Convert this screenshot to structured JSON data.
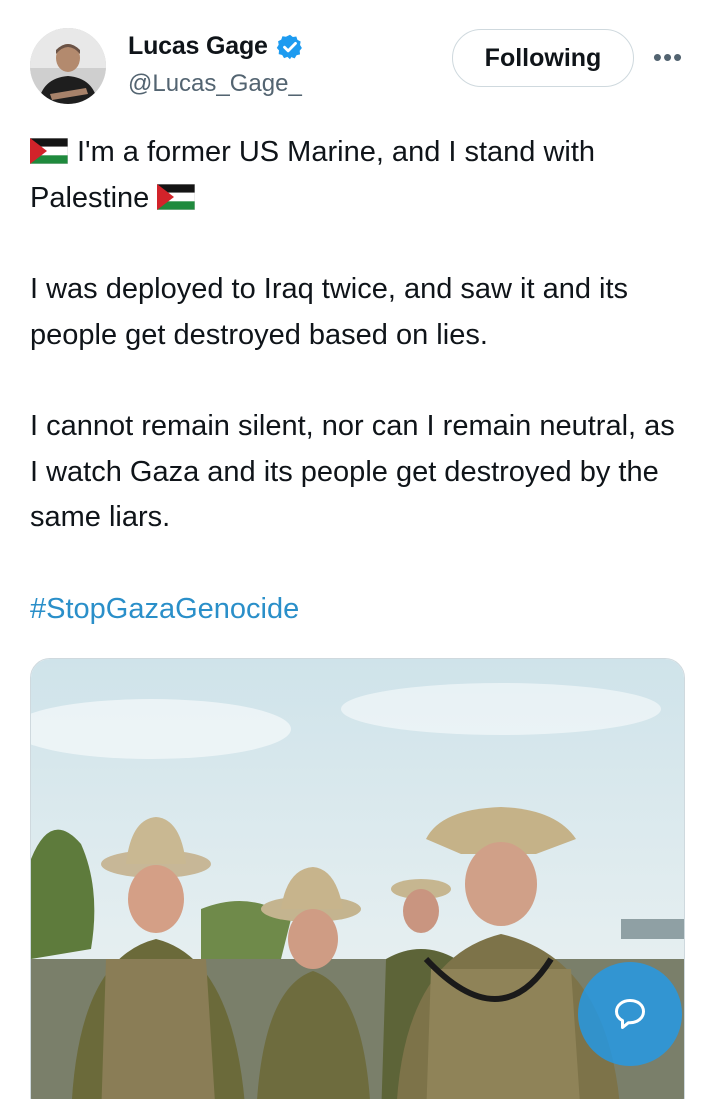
{
  "author": {
    "name": "Lucas Gage",
    "handle": "@Lucas_Gage_",
    "verified": true,
    "avatar_icon": "profile-photo"
  },
  "actions": {
    "follow_label": "Following",
    "more_label": "•••"
  },
  "tweet": {
    "line1": "I'm a former US Marine, and I stand with Palestine",
    "para2": "I was deployed to Iraq twice, and saw it and its people get destroyed based on lies.",
    "para3": "I cannot remain silent, nor can I remain neutral, as I watch Gaza and its people get destroyed by the same liars.",
    "hashtag": "#StopGazaGenocide",
    "flag_icon": "palestine-flag-icon"
  },
  "media": {
    "type": "photo",
    "icon": "photo-soldiers"
  },
  "colors": {
    "accent": "#1d9bf0",
    "hashtag": "#2a8fc9",
    "secondary_text": "#536471",
    "border": "#cfd9de",
    "flag_red": "#d2232a",
    "flag_green": "#1f8a3d"
  },
  "overlay": {
    "chat_icon": "chat-bubble-icon"
  }
}
